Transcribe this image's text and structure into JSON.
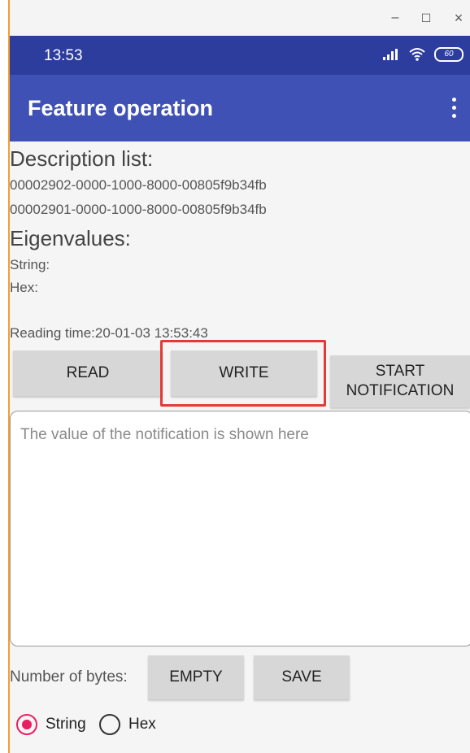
{
  "window": {
    "minimize": "–",
    "maximize": "☐",
    "close": "×"
  },
  "statusbar": {
    "time": "13:53",
    "signal_icon": "signal-icon",
    "wifi_icon": "wifi-icon",
    "battery": "60"
  },
  "appbar": {
    "title": "Feature operation",
    "menu_icon": "more-vert-icon"
  },
  "description": {
    "heading": "Description list:",
    "items": [
      "00002902-0000-1000-8000-00805f9b34fb",
      "00002901-0000-1000-8000-00805f9b34fb"
    ]
  },
  "eigenvalues": {
    "heading": "Eigenvalues:",
    "string_label": "String:",
    "hex_label": "Hex:"
  },
  "reading_time": "Reading time:20-01-03 13:53:43",
  "buttons": {
    "read": "READ",
    "write": "WRITE",
    "start_notification": "START NOTIFICATION",
    "empty": "EMPTY",
    "save": "SAVE"
  },
  "notification": {
    "placeholder": "The value of the notification is shown here"
  },
  "bytes_label": "Number of bytes:",
  "format": {
    "options": [
      "String",
      "Hex"
    ],
    "selected": "String"
  },
  "colors": {
    "statusbar": "#2c3d9e",
    "appbar": "#3f51b5",
    "accent": "#e91e63",
    "highlight": "#e53935"
  }
}
